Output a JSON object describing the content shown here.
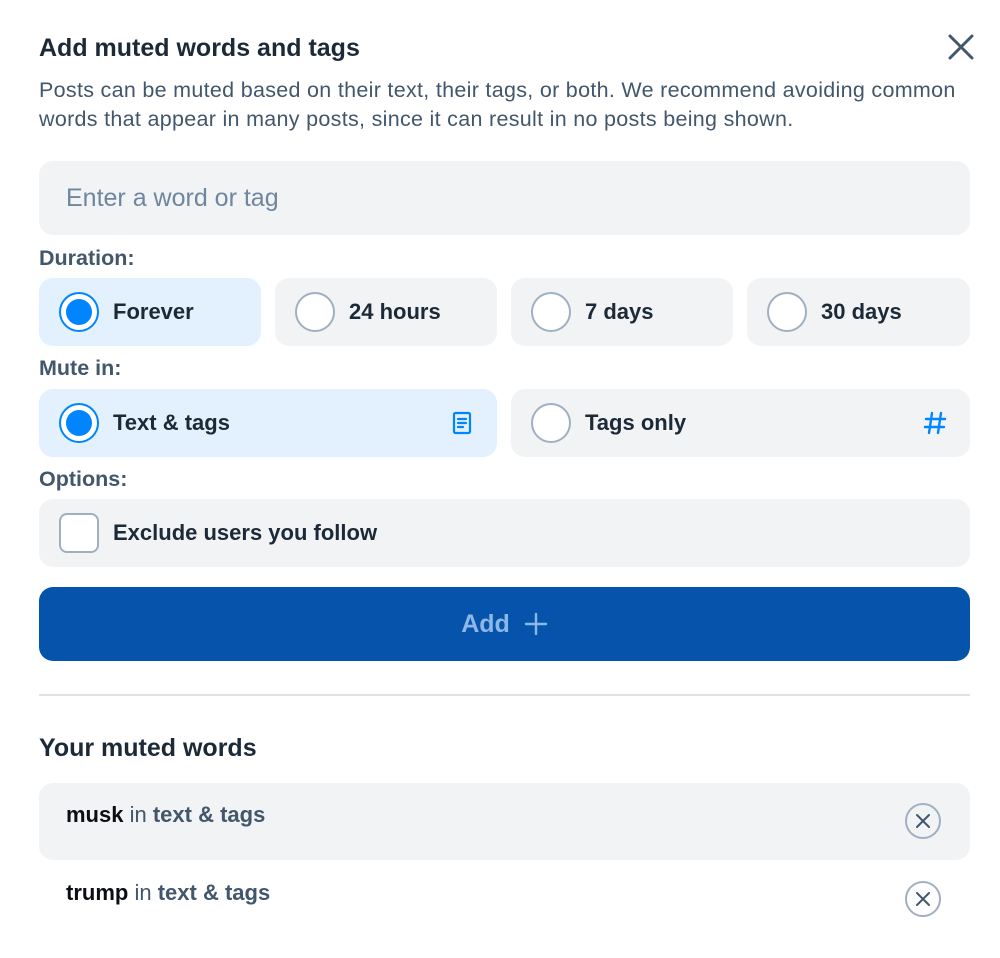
{
  "dialog": {
    "title": "Add muted words and tags",
    "description": "Posts can be muted based on their text, their tags, or both. We recommend avoiding common words that appear in many posts, since it can result in no posts being shown.",
    "close_icon": "close-icon"
  },
  "input": {
    "placeholder": "Enter a word or tag",
    "value": ""
  },
  "duration": {
    "label": "Duration:",
    "selected": "Forever",
    "options": [
      {
        "label": "Forever"
      },
      {
        "label": "24 hours"
      },
      {
        "label": "7 days"
      },
      {
        "label": "30 days"
      }
    ]
  },
  "mute_in": {
    "label": "Mute in:",
    "selected": "Text & tags",
    "options": [
      {
        "label": "Text & tags",
        "icon": "document-icon"
      },
      {
        "label": "Tags only",
        "icon": "hashtag-icon"
      }
    ]
  },
  "options": {
    "label": "Options:",
    "exclude_following": {
      "label": "Exclude users you follow",
      "checked": false
    }
  },
  "add_button": {
    "label": "Add",
    "icon": "plus-icon"
  },
  "muted_words": {
    "title": "Your muted words",
    "connector": "in",
    "items": [
      {
        "word": "musk",
        "scope": "text & tags"
      },
      {
        "word": "trump",
        "scope": "text & tags"
      }
    ]
  },
  "colors": {
    "accent": "#0085ff",
    "button": "#0553ab",
    "selected_bg": "#e3f0fd",
    "option_bg": "#f1f3f5"
  }
}
